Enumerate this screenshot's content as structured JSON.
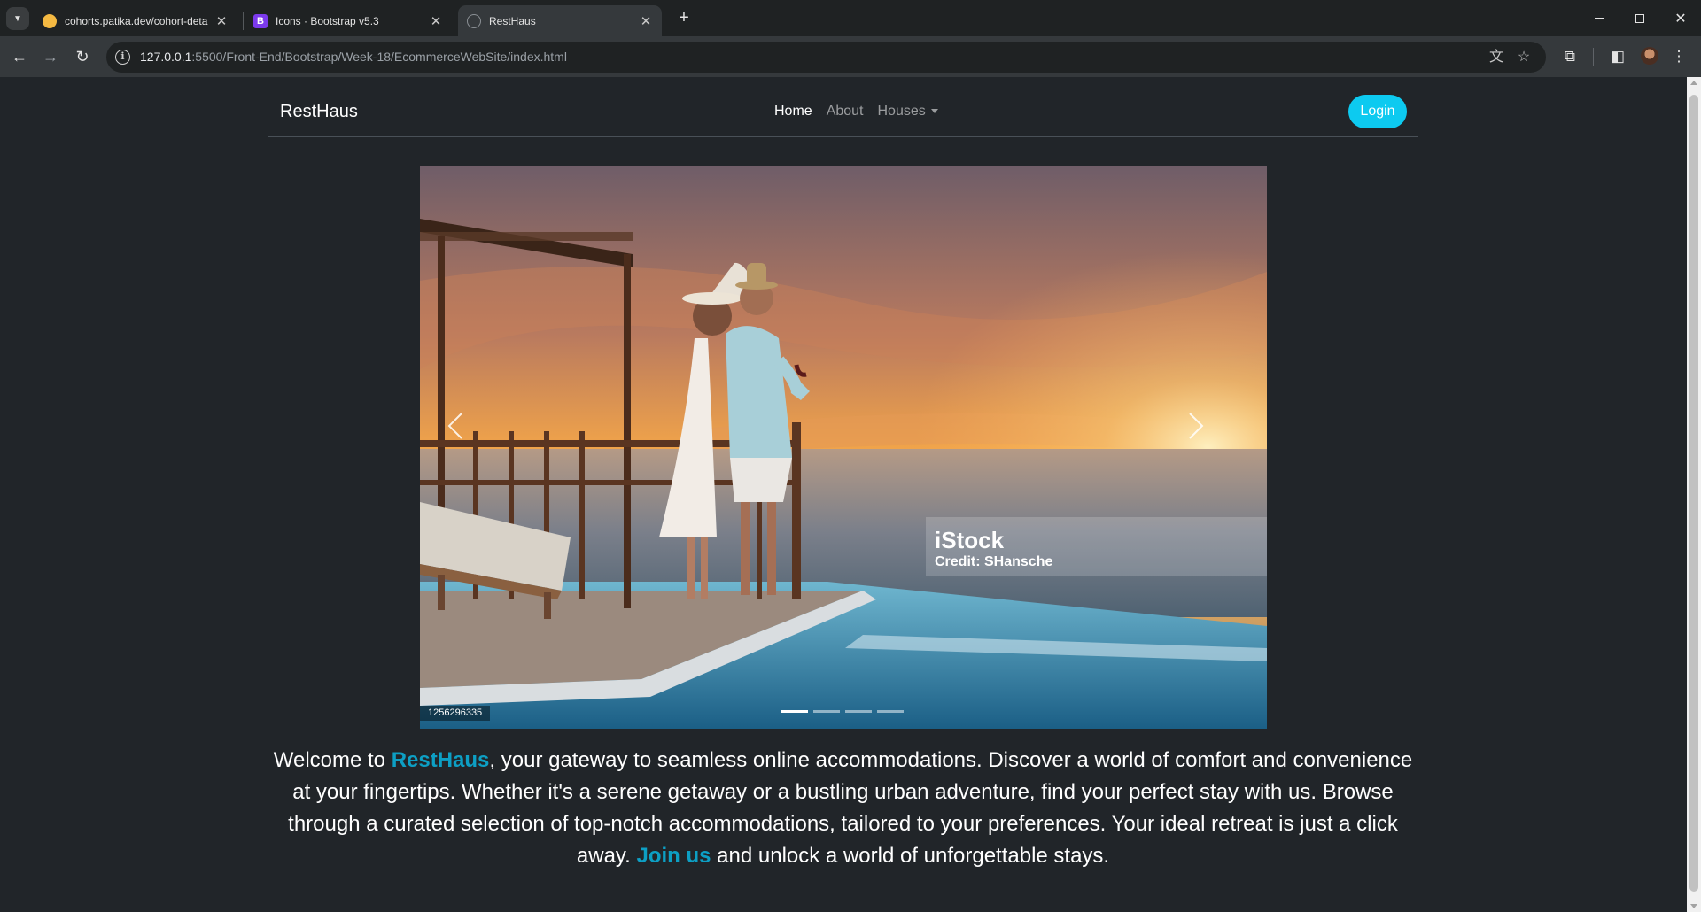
{
  "browser": {
    "tabs": [
      {
        "title": "cohorts.patika.dev/cohort-deta",
        "favicon": "patika-favicon",
        "active": false
      },
      {
        "title": "Icons · Bootstrap v5.3",
        "favicon": "bootstrap-favicon",
        "favicon_letter": "B",
        "active": false
      },
      {
        "title": "RestHaus",
        "favicon": "globe-favicon",
        "active": true
      }
    ],
    "url_host": "127.0.0.1",
    "url_rest": ":5500/Front-End/Bootstrap/Week-18/EcommerceWebSite/index.html"
  },
  "navbar": {
    "brand": "RestHaus",
    "links": [
      "Home",
      "About",
      "Houses"
    ],
    "login_label": "Login"
  },
  "carousel": {
    "watermark_brand": "iStock",
    "watermark_credit": "Credit: SHansche",
    "image_id": "1256296335",
    "indicator_count": 4,
    "active_indicator": 0
  },
  "intro": {
    "part1": "Welcome to ",
    "brand": "RestHaus",
    "part2": ", your gateway to seamless online accommodations. Discover a world of comfort and convenience at your fingertips. Whether it's a serene getaway or a bustling urban adventure, find your perfect stay with us. Browse through a curated selection of top-notch accommodations, tailored to your preferences. Your ideal retreat is just a click away. ",
    "join": "Join us",
    "part3": " and unlock a world of unforgettable stays."
  },
  "colors": {
    "page_bg": "#212529",
    "accent": "#0dcaf0",
    "highlight": "#0d9fc4"
  }
}
